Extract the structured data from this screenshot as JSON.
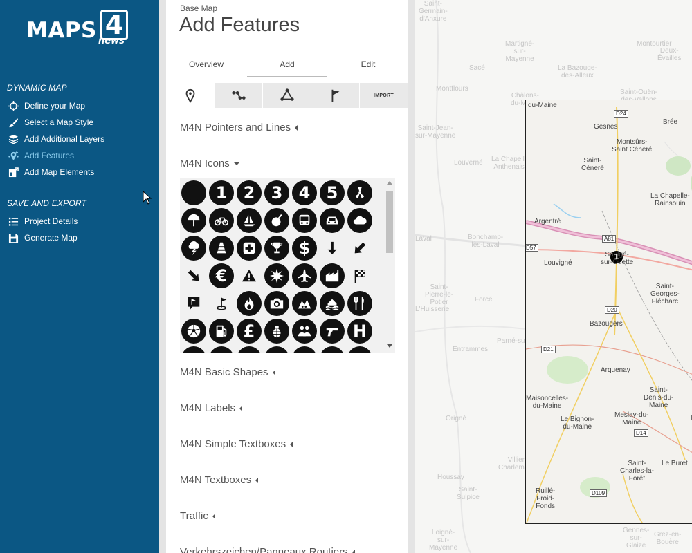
{
  "sidebar": {
    "logo": {
      "brand": "MAPS",
      "digit": "4",
      "sub": "news"
    },
    "dynamic_map_title": "DYNAMIC MAP",
    "dynamic_items": [
      {
        "label": "Define your Map",
        "icon": "crosshair-icon"
      },
      {
        "label": "Select a Map Style",
        "icon": "brush-icon"
      },
      {
        "label": "Add Additional Layers",
        "icon": "layers-icon"
      },
      {
        "label": "Add Features",
        "icon": "pin-add-icon",
        "active": true
      },
      {
        "label": "Add Map Elements",
        "icon": "map-elements-icon"
      }
    ],
    "save_title": "SAVE AND EXPORT",
    "save_items": [
      {
        "label": "Project Details",
        "icon": "list-icon"
      },
      {
        "label": "Generate Map",
        "icon": "save-icon"
      }
    ]
  },
  "panel": {
    "breadcrumb": "Base Map",
    "title": "Add Features",
    "tabs": [
      "Overview",
      "Add",
      "Edit"
    ],
    "active_tab": "Add",
    "tools": [
      {
        "icon": "location-pin-icon"
      },
      {
        "icon": "polyline-icon"
      },
      {
        "icon": "polygon-icon"
      },
      {
        "icon": "flag-icon"
      },
      {
        "label": "IMPORT"
      }
    ],
    "categories": {
      "pointers": "M4N Pointers and Lines",
      "icons": "M4N Icons",
      "basic_shapes": "M4N Basic Shapes",
      "labels": "M4N Labels",
      "simple_textboxes": "M4N Simple Textboxes",
      "textboxes": "M4N Textboxes",
      "traffic": "Traffic",
      "verkehr": "Verkehrszeichen/Panneaux Routiers"
    },
    "icon_rows": [
      [
        "dot-icon",
        "1",
        "2",
        "3",
        "4",
        "5",
        "radiation-icon"
      ],
      [
        "beach-umbrella-icon",
        "bicycle-icon",
        "sailboat-icon",
        "bomb-icon",
        "bus-icon",
        "car-icon",
        "cloud-icon"
      ],
      [
        "storm-icon",
        "cone-icon",
        "medical-cross-icon",
        "trophy-icon",
        "$",
        "arrow-down-icon",
        "arrow-down-left-icon"
      ],
      [
        "arrow-down-right-icon",
        "€",
        "warning-icon",
        "explosion-icon",
        "airplane-icon",
        "factory-icon",
        "checkered-flag-icon"
      ],
      [
        "flag-pin-icon",
        "golf-flag-icon",
        "fire-icon",
        "camera-icon",
        "landslide-icon",
        "flood-icon",
        "restaurant-icon"
      ],
      [
        "soccer-ball-icon",
        "fuel-icon",
        "£",
        "grenade-icon",
        "people-icon",
        "gun-icon",
        "H"
      ]
    ]
  },
  "map": {
    "outside_labels": [
      "Saint-\nGermain-\nd'Anxure",
      "Martigné-\nsur-\nMayenne",
      "Montourtier",
      "Deux-\nÉvailles",
      "Sacé",
      "La Bazouge-\ndes-Alleux",
      "Montflours",
      "Châlons-\ndu-Maine",
      "Saint-Ouën-\ndes-Vallons",
      "Saint-Jean-\nsur-Mayenne",
      "Louverné",
      "La Chapelle-\nAnthenaise",
      "Laval",
      "Bonchamp-\nlès-Laval",
      "Saint-\nPierre-le-\nPotier",
      "L'Huisserie",
      "Forcé",
      "Parné-sur-Roc",
      "Entrammes",
      "Origné",
      "Villiers-\nCharlemagne",
      "Houssay",
      "Saint-\nSulpice",
      "Loigné-\nsur-\nMayenne",
      "Gennes-\nsur-\nGlaize",
      "Grez-en-\nBouère",
      "Ruillé-\nFroid-\nFonds"
    ],
    "frame_labels": [
      "du-Maine",
      "Gesnes",
      "Montsûrs-\nSaint Céneré",
      "Brée",
      "Saint-\nCéneré",
      "La Chapelle-\nRainsouin",
      "Argentré",
      "Soulgé-\nsur-Ouette",
      "Louvigné",
      "Saint-\nGeorges-\nFlécharc",
      "Bazougers",
      "Arquenay",
      "Saint-\nDenis-du-\nMaine",
      "Maisoncelles-\ndu-Maine",
      "Le Bignon-\ndu-Maine",
      "Meslay-du-\nMaine",
      "La",
      "Saint-\nCharles-la-\nForêt",
      "Le Buret",
      "Ruillé-\nFroid-\nFonds"
    ],
    "roads": [
      "D24",
      "D57",
      "A81",
      "D20",
      "D21",
      "D14",
      "D109"
    ],
    "marker": "1"
  }
}
